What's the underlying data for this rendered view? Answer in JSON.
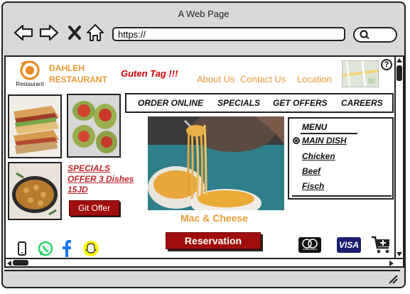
{
  "browser": {
    "title": "A Web Page",
    "url": "https://"
  },
  "header": {
    "logo_caption": "Restaurant",
    "brand_line1": "DAHLEH",
    "brand_line2": "RESTAURANT",
    "greeting": "Guten Tag !!!",
    "links": [
      "About Us",
      "Contact Us",
      "Location"
    ],
    "help": "?"
  },
  "nav": {
    "items": [
      "ORDER ONLINE",
      "SPECIALS",
      "GET OFFERS",
      "CAREERS"
    ]
  },
  "specials": {
    "line1": "SPECIALS",
    "line2": "OFFER 3 Dishes",
    "line3": "15JD",
    "button": "Git Offer"
  },
  "hero": {
    "caption": "Mac & Cheese"
  },
  "menu": {
    "title": "MENU",
    "items": [
      "MAIN DISH",
      "Chicken",
      "Beef",
      "Fisch"
    ]
  },
  "footer": {
    "reservation": "Reservation",
    "visa": "VISA",
    "mastercard_caption": "mastercard"
  },
  "colors": {
    "accent": "#e89a36",
    "brand_red": "#a00d0d",
    "whatsapp": "#25d366",
    "facebook": "#1877f2",
    "snapchat": "#fffc00"
  }
}
